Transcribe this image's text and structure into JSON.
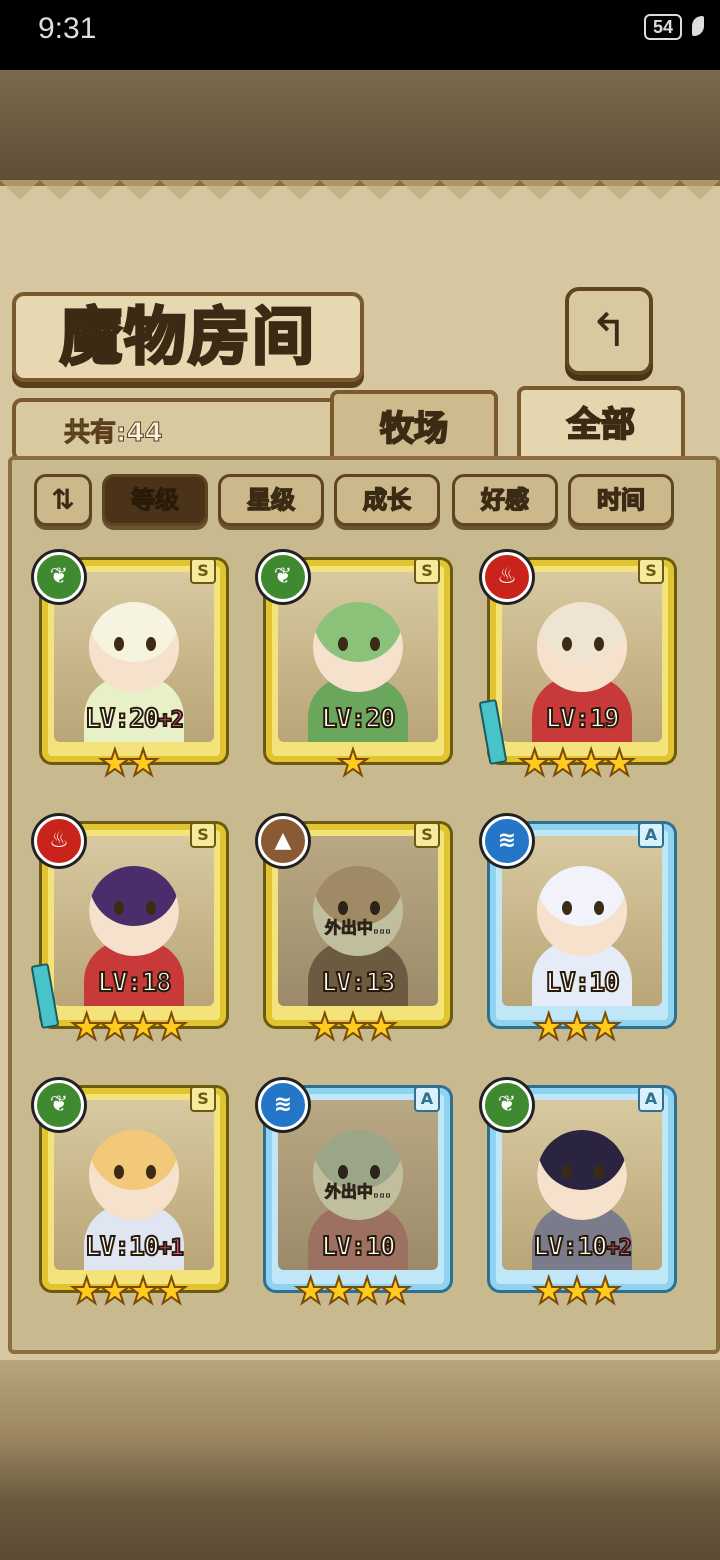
{
  "status_bar": {
    "time": "9:31",
    "battery": "54"
  },
  "title": "魔物房间",
  "count_label": "共有:44",
  "tabs": [
    {
      "label": "牧场"
    },
    {
      "label": "全部",
      "active": true
    }
  ],
  "sort_buttons": [
    {
      "label": "等级",
      "active": true
    },
    {
      "label": "星级"
    },
    {
      "label": "成长"
    },
    {
      "label": "好感"
    },
    {
      "label": "时间"
    }
  ],
  "monsters": [
    {
      "element": "grass",
      "rank": "S",
      "level": "LV:20",
      "bonus": "+2",
      "stars": 2,
      "status": ""
    },
    {
      "element": "grass",
      "rank": "S",
      "level": "LV:20",
      "bonus": "",
      "stars": 1,
      "status": ""
    },
    {
      "element": "fire",
      "rank": "S",
      "level": "LV:19",
      "bonus": "",
      "stars": 4,
      "status": ""
    },
    {
      "element": "fire",
      "rank": "S",
      "level": "LV:18",
      "bonus": "",
      "stars": 4,
      "status": ""
    },
    {
      "element": "earth",
      "rank": "S",
      "level": "LV:13",
      "bonus": "",
      "stars": 3,
      "status": "外出中..."
    },
    {
      "element": "water",
      "rank": "A",
      "level": "LV:10",
      "bonus": "",
      "stars": 3,
      "status": ""
    },
    {
      "element": "grass",
      "rank": "S",
      "level": "LV:10",
      "bonus": "+1",
      "stars": 4,
      "status": ""
    },
    {
      "element": "water",
      "rank": "A",
      "level": "LV:10",
      "bonus": "",
      "stars": 4,
      "status": "外出中..."
    },
    {
      "element": "grass",
      "rank": "A",
      "level": "LV:10",
      "bonus": "+2",
      "stars": 3,
      "status": ""
    }
  ]
}
